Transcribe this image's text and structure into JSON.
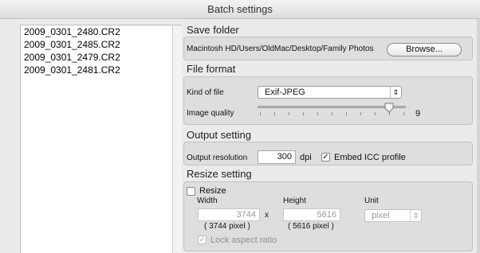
{
  "window": {
    "title": "Batch settings"
  },
  "file_list": {
    "items": [
      "2009_0301_2480.CR2",
      "2009_0301_2485.CR2",
      "2009_0301_2479.CR2",
      "2009_0301_2481.CR2"
    ]
  },
  "save_folder": {
    "title": "Save folder",
    "path": "Macintosh HD/Users/OldMac/Desktop/Family Photos",
    "browse_label": "Browse..."
  },
  "file_format": {
    "title": "File format",
    "kind_label": "Kind of file",
    "kind_value": "Exif-JPEG",
    "quality_label": "Image quality",
    "quality_value": "9",
    "quality_level": 9,
    "quality_max": 10
  },
  "output_setting": {
    "title": "Output setting",
    "resolution_label": "Output resolution",
    "resolution_value": "300",
    "resolution_unit": "dpi",
    "embed_icc_label": "Embed ICC profile",
    "embed_icc_checked": true
  },
  "resize_setting": {
    "title": "Resize setting",
    "resize_label": "Resize",
    "resize_checked": false,
    "width_label": "Width",
    "height_label": "Height",
    "unit_label": "Unit",
    "width_value": "3744",
    "height_value": "5616",
    "x_label": "x",
    "width_pixels": "( 3744 pixel )",
    "height_pixels": "( 5616 pixel )",
    "unit_value": "pixel",
    "lock_label": "Lock aspect ratio",
    "lock_checked": true
  }
}
